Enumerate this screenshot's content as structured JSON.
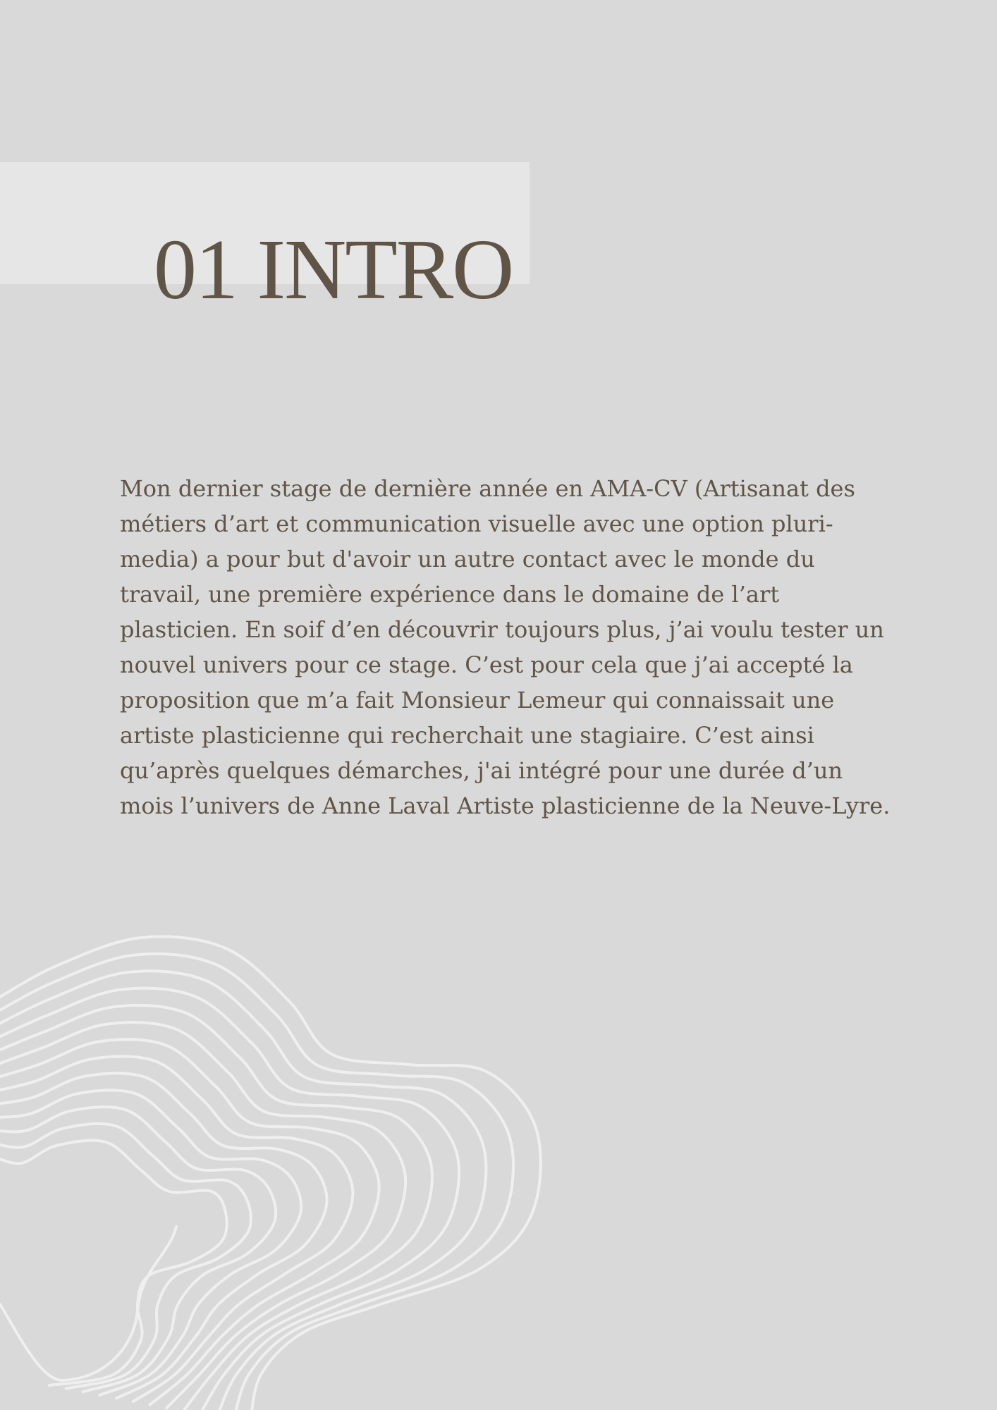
{
  "page": {
    "background_color": "#d9d9d9",
    "band_color": "#e6e6e6",
    "text_color": "#5f5446",
    "contour_color": "#efefef"
  },
  "header": {
    "title": "01 INTRO"
  },
  "intro": {
    "lines": [
      "Mon dernier stage de dernière année en AMA-CV (Artisanat des",
      "métiers d’art et communication visuelle avec une option pluri-",
      "media) a pour but d'avoir un autre contact avec le monde du",
      "travail, une première expérience dans le domaine de l’art",
      "plasticien. En soif d’en découvrir toujours plus, j’ai voulu tester un",
      "nouvel univers pour ce stage. C’est pour cela que j’ai accepté la",
      "proposition que m’a fait Monsieur Lemeur qui connaissait une",
      "artiste plasticienne qui recherchait une stagiaire. C’est ainsi",
      "qu’après quelques démarches, j'ai intégré pour une durée d’un",
      "mois l’univers de Anne Laval Artiste plasticienne de la Neuve-Lyre."
    ]
  },
  "decoration": {
    "icon": "topographic-contour-lines-icon"
  }
}
